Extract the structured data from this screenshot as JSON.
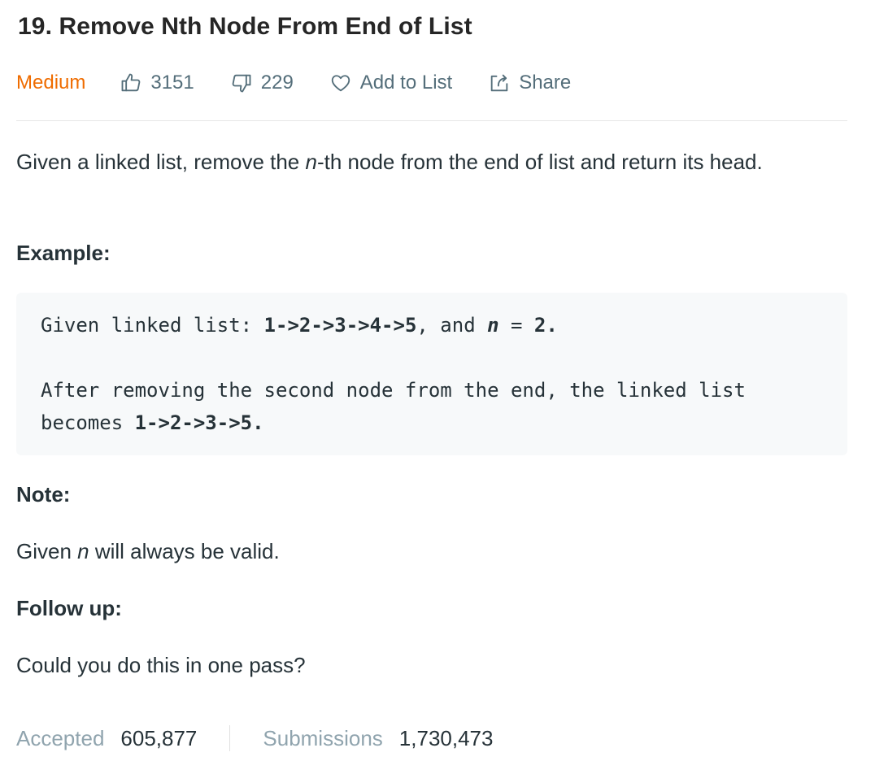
{
  "problem": {
    "title": "19. Remove Nth Node From End of List",
    "difficulty": "Medium",
    "likes": "3151",
    "dislikes": "229",
    "add_to_list": "Add to List",
    "share": "Share"
  },
  "description": {
    "part1": "Given a linked list, remove the ",
    "var_n": "n",
    "part2": "-th node from the end of list and return its head."
  },
  "example": {
    "heading": "Example:",
    "line1_prefix": "Given linked list: ",
    "line1_list": "1->2->3->4->5",
    "line1_mid": ", and ",
    "line1_var": "n",
    "line1_eq": " = ",
    "line1_val": "2.",
    "line2": "After removing the second node from the end, the linked list",
    "line3_prefix": "becomes ",
    "line3_list": "1->2->3->5."
  },
  "note": {
    "heading": "Note:",
    "text_prefix": "Given ",
    "text_var": "n",
    "text_suffix": " will always be valid."
  },
  "followup": {
    "heading": "Follow up:",
    "text": "Could you do this in one pass?"
  },
  "stats": {
    "accepted_label": "Accepted",
    "accepted_value": "605,877",
    "submissions_label": "Submissions",
    "submissions_value": "1,730,473"
  },
  "colors": {
    "difficulty_medium": "#ef6c00",
    "meta_text": "#546e7a",
    "code_bg": "#f7f9fa",
    "muted_label": "#90a4ae"
  },
  "icons": {
    "likes": "thumbs-up-icon",
    "dislikes": "thumbs-down-icon",
    "add_to_list": "heart-icon",
    "share": "share-icon"
  }
}
